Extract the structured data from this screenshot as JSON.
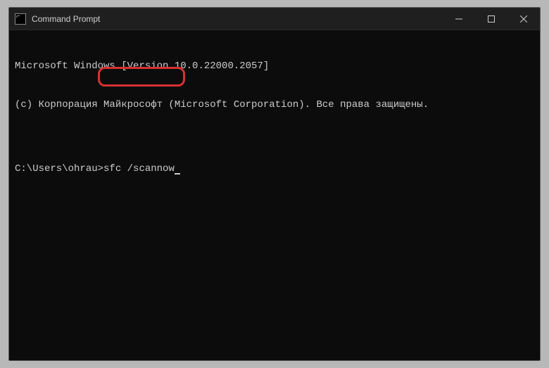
{
  "window": {
    "title": "Command Prompt"
  },
  "terminal": {
    "line1": "Microsoft Windows [Version 10.0.22000.2057]",
    "line2": "(c) Корпорация Майкрософт (Microsoft Corporation). Все права защищены.",
    "blank": "",
    "prompt": "C:\\Users\\ohrau>",
    "command": "sfc /scannow"
  }
}
